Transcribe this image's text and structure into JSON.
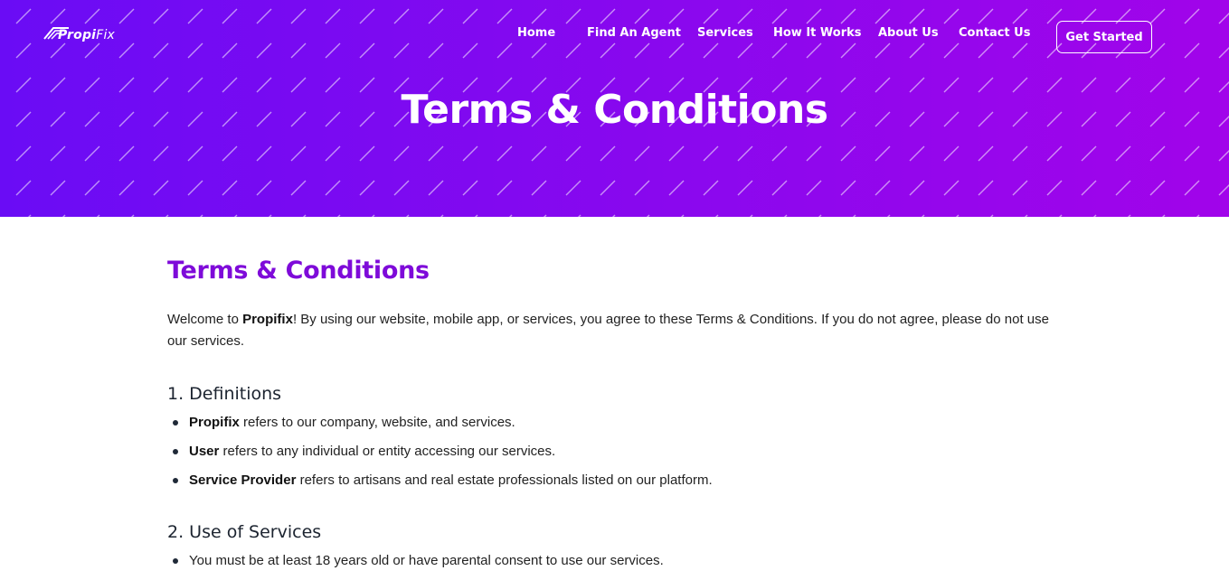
{
  "brand": {
    "logo_text_a": "Propi",
    "logo_text_b": "Fix"
  },
  "nav": {
    "items": [
      {
        "label": "Home"
      },
      {
        "label": "Find An Agent"
      },
      {
        "label": "Services"
      },
      {
        "label": "How It Works"
      },
      {
        "label": "About Us"
      },
      {
        "label": "Contact Us"
      }
    ],
    "cta_label": "Get Started"
  },
  "hero": {
    "title": "Terms & Conditions"
  },
  "content": {
    "heading": "Terms & Conditions",
    "intro_prefix": "Welcome to ",
    "intro_brand": "Propifix",
    "intro_suffix": "! By using our website, mobile app, or services, you agree to these Terms & Conditions. If you do not agree, please do not use our services.",
    "sections": [
      {
        "title": "1. Definitions",
        "items": [
          {
            "term": "Propifix",
            "text": " refers to our company, website, and services."
          },
          {
            "term": "User",
            "text": " refers to any individual or entity accessing our services."
          },
          {
            "term": "Service Provider",
            "text": " refers to artisans and real estate professionals listed on our platform."
          }
        ]
      },
      {
        "title": "2. Use of Services",
        "items": [
          {
            "text": "You must be at least 18 years old or have parental consent to use our services."
          }
        ]
      }
    ]
  },
  "colors": {
    "hero_gradient_start": "#6a0cf5",
    "hero_gradient_end": "#a104ea",
    "heading_purple": "#7e0ad9",
    "body_text": "#222222"
  }
}
